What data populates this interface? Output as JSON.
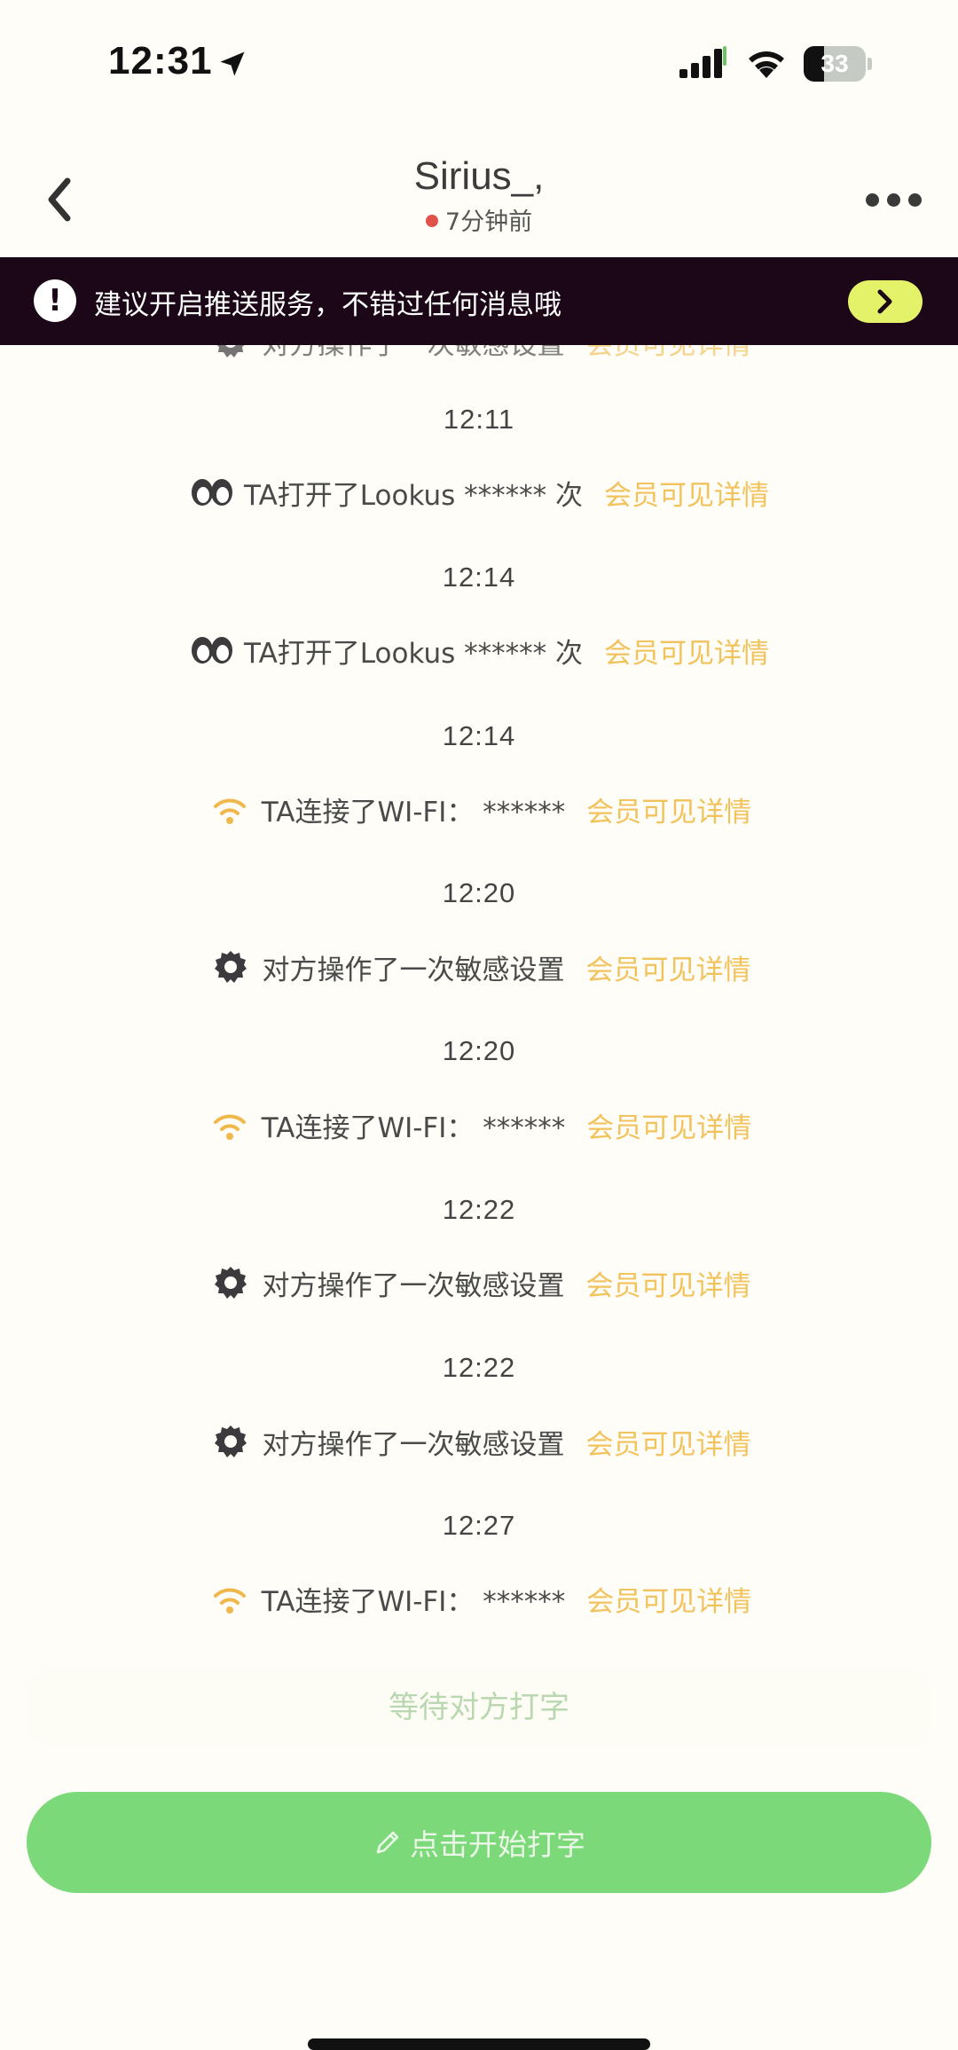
{
  "status_bar": {
    "time": "12:31",
    "battery": "33",
    "battery_level": 0.33
  },
  "header": {
    "title": "Sirius_,",
    "subtitle": "7分钟前",
    "status_color": "#e0524a"
  },
  "notice": {
    "text": "建议开启推送服务，不错过任何消息哦",
    "icon": "exclamation-icon",
    "action_icon": "chevron-right-icon",
    "accent": "#e4f26a"
  },
  "timeline": {
    "partial_event": {
      "icon": "gear-icon",
      "text": "对方操作了一次敏感设置",
      "link": "会员可见详情"
    },
    "entries": [
      {
        "time": "12:11",
        "icon": "eyes-icon",
        "text": "TA打开了Lookus ****** 次",
        "link": "会员可见详情"
      },
      {
        "time": "12:14",
        "icon": "eyes-icon",
        "text": "TA打开了Lookus ****** 次",
        "link": "会员可见详情"
      },
      {
        "time": "12:14",
        "icon": "wifi-icon",
        "text": "TA连接了WI-FI：  ******",
        "link": "会员可见详情"
      },
      {
        "time": "12:20",
        "icon": "gear-icon",
        "text": "对方操作了一次敏感设置",
        "link": "会员可见详情"
      },
      {
        "time": "12:20",
        "icon": "wifi-icon",
        "text": "TA连接了WI-FI：  ******",
        "link": "会员可见详情"
      },
      {
        "time": "12:22",
        "icon": "gear-icon",
        "text": "对方操作了一次敏感设置",
        "link": "会员可见详情"
      },
      {
        "time": "12:22",
        "icon": "gear-icon",
        "text": "对方操作了一次敏感设置",
        "link": "会员可见详情"
      },
      {
        "time": "12:27",
        "icon": "wifi-icon",
        "text": "TA连接了WI-FI：  ******",
        "link": "会员可见详情"
      }
    ]
  },
  "bottom": {
    "typing_status": "等待对方打字",
    "start_button": "点击开始打字",
    "button_color": "#7cd97a",
    "link_color": "#f2c25c"
  }
}
